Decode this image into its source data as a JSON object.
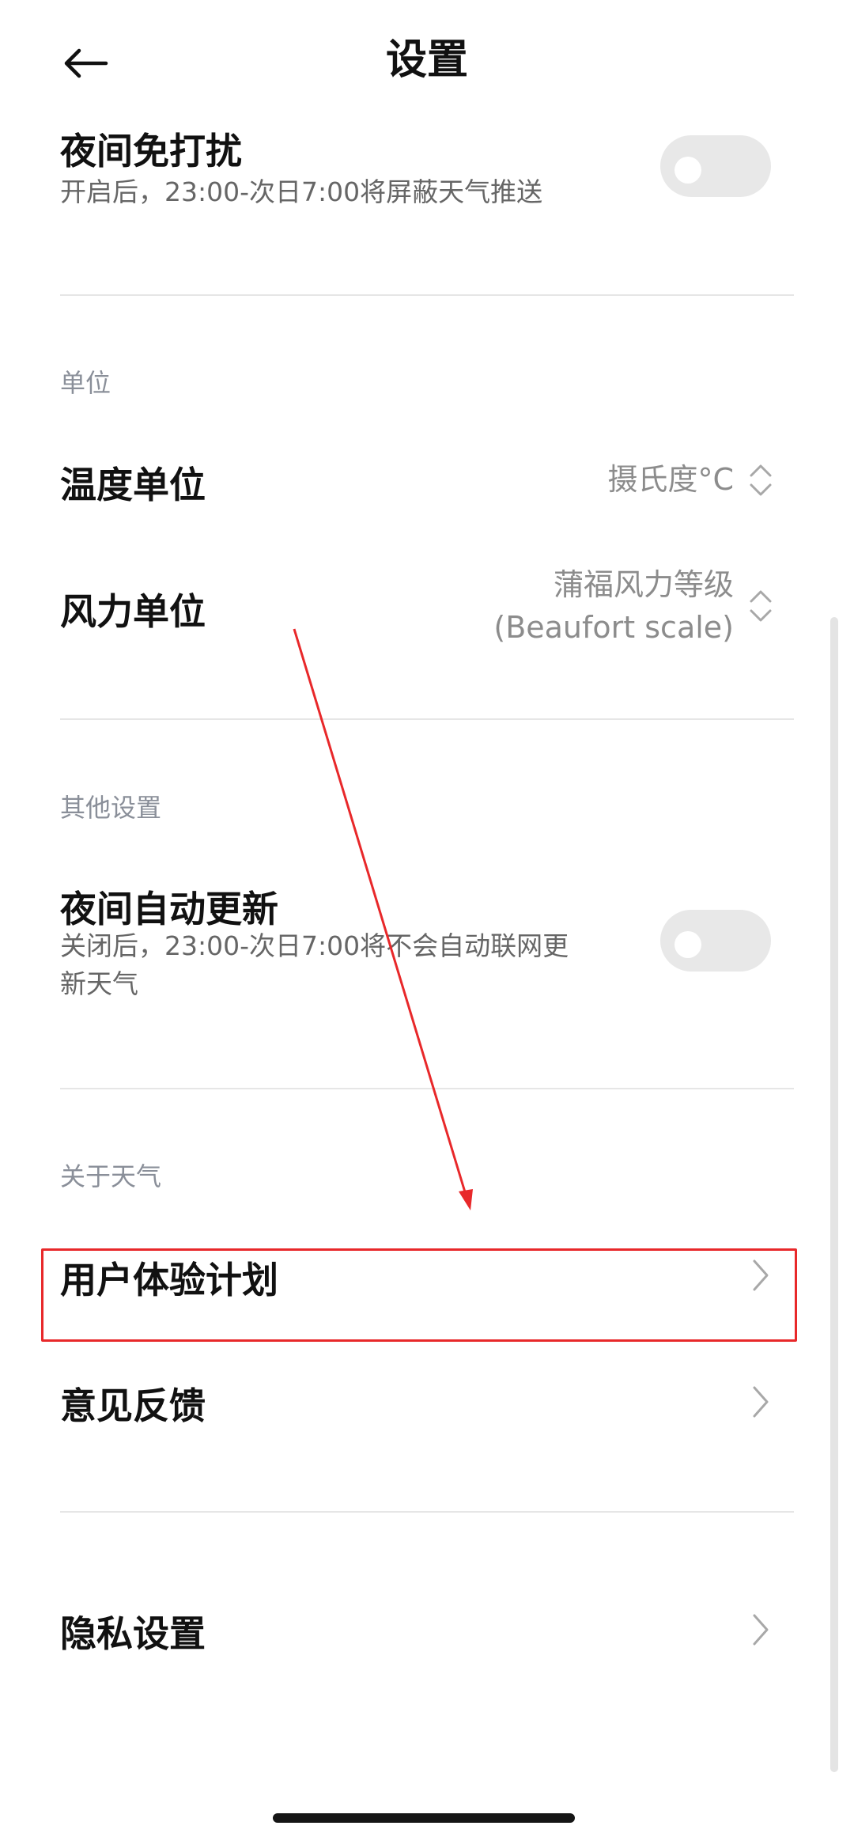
{
  "header": {
    "title": "设置",
    "back_icon": "arrow-left-icon"
  },
  "night_dnd": {
    "title": "夜间免打扰",
    "subtitle": "开启后，23:00-次日7:00将屏蔽天气推送",
    "enabled": false
  },
  "units": {
    "section_label": "单位",
    "temperature": {
      "title": "温度单位",
      "value": "摄氏度°C"
    },
    "wind": {
      "title": "风力单位",
      "value_line1": "蒲福风力等级",
      "value_line2": "(Beaufort scale)"
    }
  },
  "other_settings": {
    "section_label": "其他设置",
    "night_auto_update": {
      "title": "夜间自动更新",
      "subtitle_line1": "关闭后，23:00-次日7:00将不会自动联网更",
      "subtitle_line2": "新天气",
      "enabled": false
    }
  },
  "about": {
    "section_label": "关于天气",
    "items": [
      {
        "label": "用户体验计划"
      },
      {
        "label": "意见反馈"
      },
      {
        "label": "隐私设置"
      }
    ]
  },
  "annotation": {
    "color": "#e8282a"
  }
}
